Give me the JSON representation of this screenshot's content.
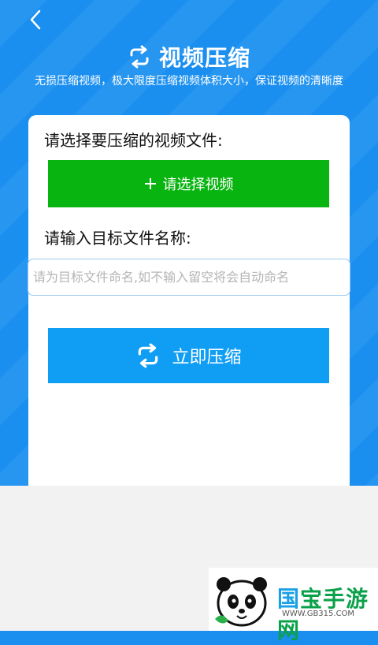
{
  "header": {
    "title": "视频压缩",
    "subtitle": "无损压缩视频，极大限度压缩视频体积大小，保证视频的清晰度"
  },
  "form": {
    "select_label": "请选择要压缩的视频文件:",
    "select_button": "请选择视频",
    "name_label": "请输入目标文件名称:",
    "name_placeholder": "请为目标文件命名,如不输入留空将会自动命名",
    "compress_button": "立即压缩"
  },
  "watermark": {
    "first_char": "国",
    "rest": "宝手游网",
    "url": "WWW.GB315.COM"
  },
  "colors": {
    "background": "#1a8ff0",
    "select_button": "#08b40f",
    "compress_button": "#109ef5"
  },
  "icons": [
    "back-arrow-icon",
    "refresh-icon",
    "plus-icon",
    "panda-logo"
  ]
}
